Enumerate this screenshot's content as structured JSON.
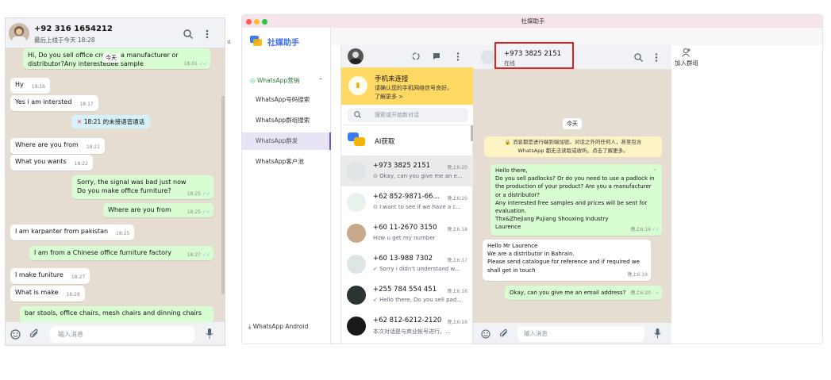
{
  "left_chat": {
    "contact_name": "+92 316 1654212",
    "last_seen": "最后上线于今天 18:28",
    "date_chip": "今天",
    "input_placeholder": "输入消息",
    "messages": [
      {
        "dir": "out",
        "text": "Hi,  Do you sell office c",
        "text2": "re you a manufacturer or distributor?Any interested",
        "text3": "ee sample",
        "time": "18:01",
        "ticks": "✓✓"
      },
      {
        "dir": "in",
        "text": "Hy",
        "time": "18:16"
      },
      {
        "dir": "in",
        "text": "Yes i am intersted",
        "time": "18:17"
      },
      {
        "dir": "sys",
        "text": "18:21 的未接语音通话"
      },
      {
        "dir": "in",
        "text": "Where are you from",
        "time": "18:21"
      },
      {
        "dir": "in",
        "text": "What you wants",
        "time": "18:22"
      },
      {
        "dir": "out",
        "text": "Sorry, the signal was bad just now",
        "text2": "Do you make office furniture?",
        "time": "18:25",
        "ticks": "✓✓"
      },
      {
        "dir": "out",
        "text": "Where are you from",
        "time": "18:25",
        "ticks": "✓✓"
      },
      {
        "dir": "in",
        "text": "I am karpanter from pakistan",
        "time": "18:25"
      },
      {
        "dir": "out",
        "text": "I am from a Chinese office furniture factory",
        "time": "18:27",
        "ticks": "✓✓"
      },
      {
        "dir": "in",
        "text": "I make funiture",
        "time": "18:27"
      },
      {
        "dir": "in",
        "text": "What is make",
        "time": "18:28"
      },
      {
        "dir": "out",
        "text": "bar stools, office chairs, mesh chairs and dinning chairs"
      }
    ]
  },
  "app": {
    "window_title": "社媒助手",
    "brand": "社媒助手",
    "nav": {
      "group": "WhatsApp营销",
      "items": [
        "WhatsApp号码搜索",
        "WhatsApp群组搜索",
        "WhatsApp群发",
        "WhatsApp客户池"
      ],
      "active_index": 2,
      "bottom": "WhatsApp Android"
    },
    "phone_banner": {
      "title": "手机未连接",
      "line1": "请确认您的手机网络信号良好。",
      "line2": "了解更多 >"
    },
    "search_placeholder": "搜索或开始新对话",
    "ai_label": "AI获取",
    "chats": [
      {
        "name": "+973 3825 2151",
        "time": "晚上6:20",
        "preview": "Okay, can you give me an e...",
        "status": "⊙"
      },
      {
        "name": "+62 852-9871-66...",
        "time": "晚上6:20",
        "preview": "I want to see if we have a c...",
        "status": "⊙"
      },
      {
        "name": "+60 11-2670 3150",
        "time": "晚上6:18",
        "preview": "How u get my number",
        "status": ""
      },
      {
        "name": "+60 13-988 7302",
        "time": "晚上6:17",
        "preview": "Sorry i didn't understand w...",
        "status": "✓"
      },
      {
        "name": "+255 784 554 451",
        "time": "晚上6:16",
        "preview": "Hello there, Do you sell pad...",
        "status": "✓"
      },
      {
        "name": "+62 812-6212-2120",
        "time": "晚上6:16",
        "preview": "本次对话是与商业帐号进行。...",
        "status": ""
      }
    ],
    "conversation": {
      "name": "+973 3825 2151",
      "status": "在线",
      "date_chip": "今天",
      "encryption": "🔒 消息都是进行端到端加密。对话之外的任何人，甚至包含",
      "encryption2": "WhatsApp 都无法读取或收听。点击了解更多。",
      "msg1": [
        "Hello there,",
        "Do you sell padlocks? Or do you need to use a padlock in",
        "the production of your product? Are you a manufacturer",
        "or a distributor?",
        "Any interested free samples and prices will be sent for",
        "evaluation.",
        "Thx&Zhejiang Pujiang Shouxing Industry",
        "Laurence"
      ],
      "msg1_time": "晚上6:16",
      "msg2": [
        "Hello Mr Laurence",
        "We are a distributor in Bahrain.",
        "Please send catalogue for reference and if required we",
        "shall get in touch"
      ],
      "msg2_time": "晚上6:19",
      "msg3": "Okay, can you give me an email address?",
      "msg3_time": "晚上6:20",
      "input_placeholder": "输入消息"
    },
    "right_panel": {
      "join_group": "加入群组"
    },
    "accent": "#25d366",
    "highlight": "#e02020"
  }
}
